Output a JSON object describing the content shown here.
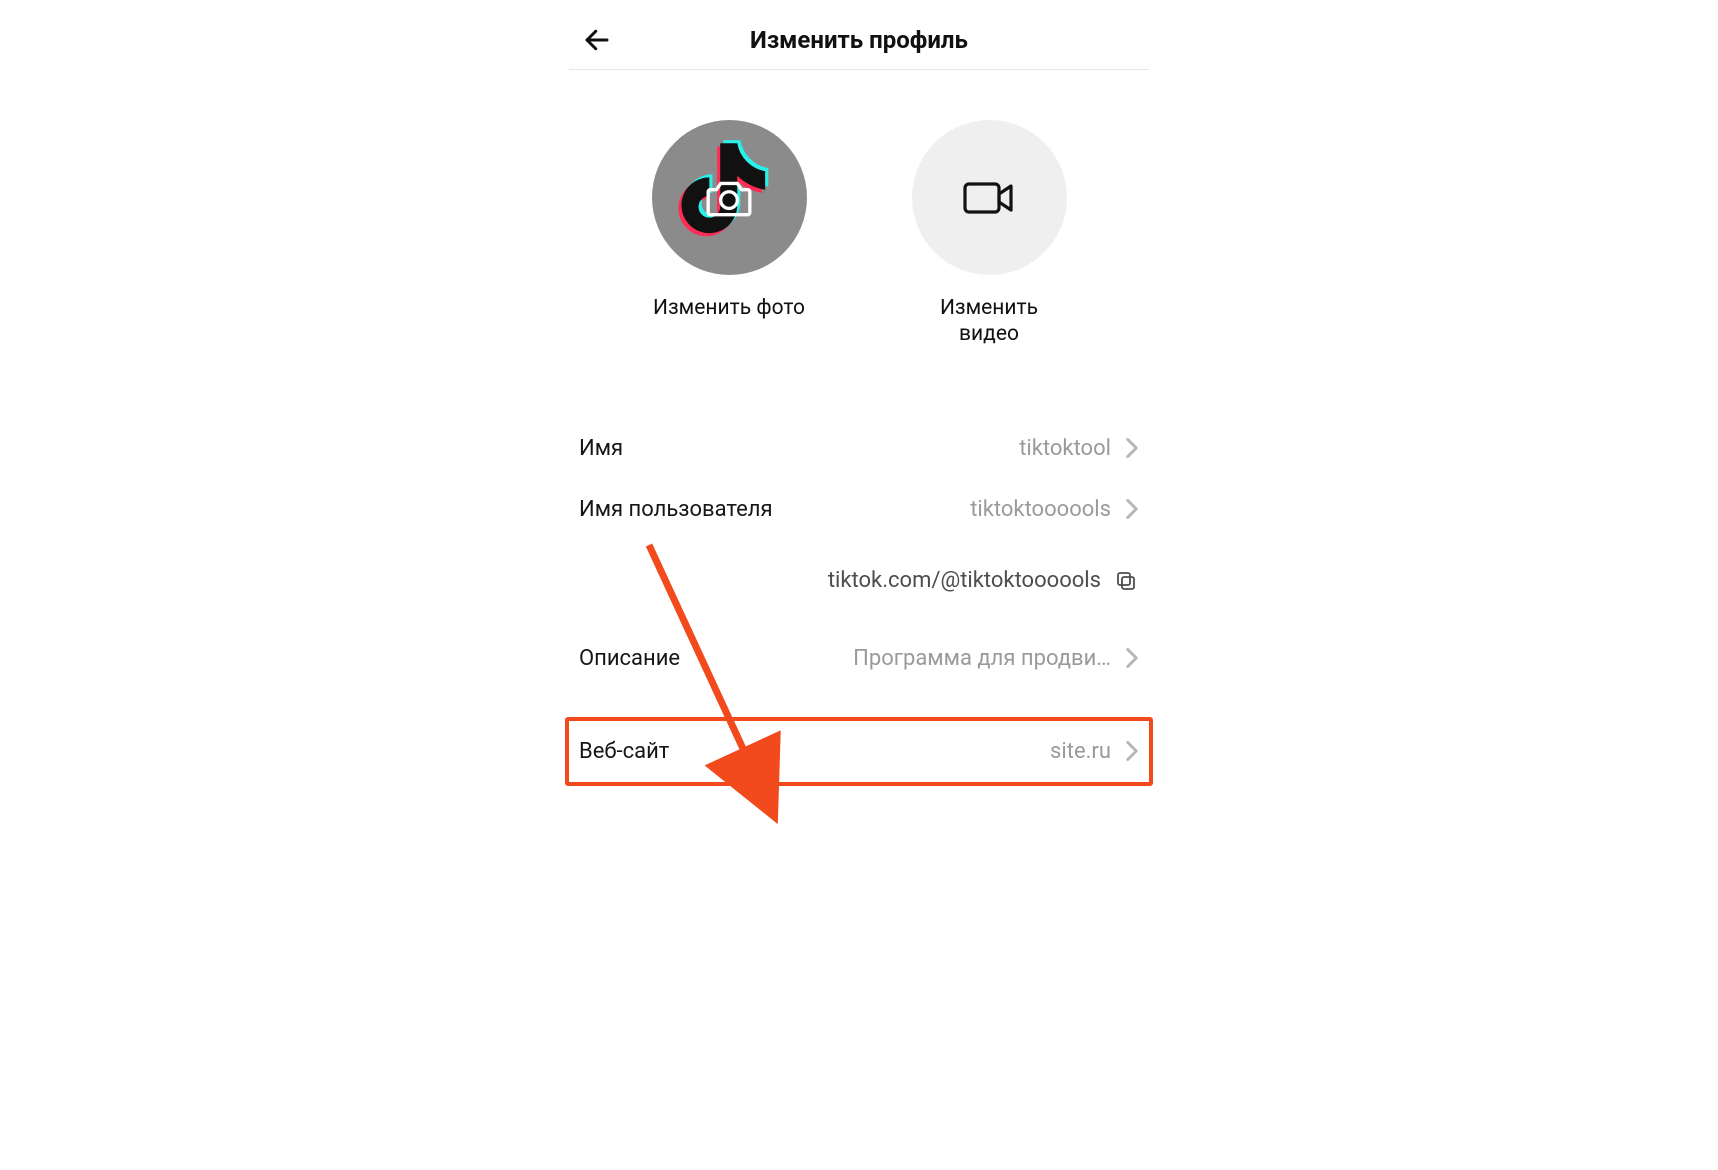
{
  "header": {
    "title": "Изменить профиль"
  },
  "media": {
    "photo_label": "Изменить фото",
    "video_label": "Изменить\nвидео"
  },
  "rows": {
    "name": {
      "label": "Имя",
      "value": "tiktoktool"
    },
    "username": {
      "label": "Имя пользователя",
      "value": "tiktoktoooools"
    },
    "link": {
      "url": "tiktok.com/@tiktoktoooools"
    },
    "bio": {
      "label": "Описание",
      "value": "Программа для продви…"
    },
    "website": {
      "label": "Веб-сайт",
      "value": "site.ru"
    }
  }
}
